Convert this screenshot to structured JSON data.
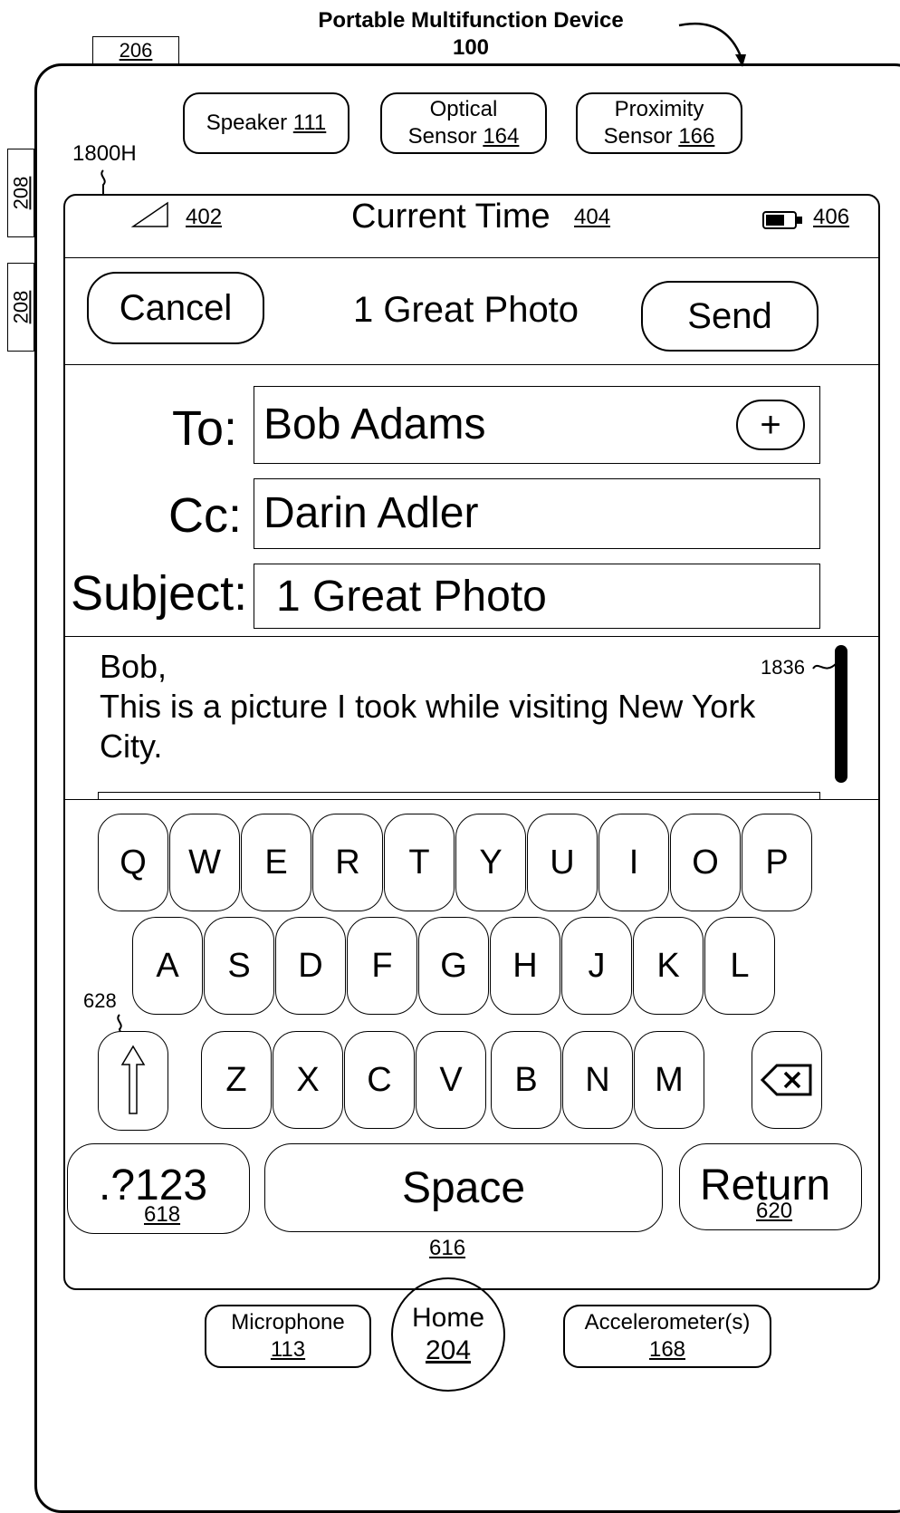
{
  "figure": {
    "title_line1": "Portable Multifunction Device",
    "title_line2": "100"
  },
  "refs": {
    "tab_top": "206",
    "side_button_1": "208",
    "side_button_2": "208",
    "screen": "1800H",
    "scroll_indicator": "1836",
    "shift_key": "628"
  },
  "hardware": {
    "speaker_label": "Speaker",
    "speaker_ref": "111",
    "optical_label": "Optical",
    "optical_label2": "Sensor",
    "optical_ref": "164",
    "proximity_label": "Proximity",
    "proximity_label2": "Sensor",
    "proximity_ref": "166",
    "microphone_label": "Microphone",
    "microphone_ref": "113",
    "home_label": "Home",
    "home_ref": "204",
    "accelerometer_label": "Accelerometer(s)",
    "accelerometer_ref": "168"
  },
  "status_bar": {
    "signal_ref": "402",
    "time_label": "Current Time",
    "time_ref": "404",
    "battery_ref": "406"
  },
  "header": {
    "cancel": "Cancel",
    "title": "1 Great Photo",
    "send": "Send"
  },
  "fields": {
    "to_label": "To:",
    "to_value": "Bob Adams",
    "add_glyph": "+",
    "cc_label": "Cc:",
    "cc_value": "Darin Adler",
    "subject_label": "Subject:",
    "subject_value": "1 Great Photo"
  },
  "body": {
    "line1": "Bob,",
    "line2": "This is a picture I took while visiting New York",
    "line3": "City."
  },
  "keyboard": {
    "row1": [
      "Q",
      "W",
      "E",
      "R",
      "T",
      "Y",
      "U",
      "I",
      "O",
      "P"
    ],
    "row2": [
      "A",
      "S",
      "D",
      "F",
      "G",
      "H",
      "J",
      "K",
      "L"
    ],
    "row3": [
      "Z",
      "X",
      "C",
      "V",
      "B",
      "N",
      "M"
    ],
    "numbers_label": ".?123",
    "numbers_ref": "618",
    "space_label": "Space",
    "space_ref": "616",
    "return_label": "Return",
    "return_ref": "620"
  }
}
